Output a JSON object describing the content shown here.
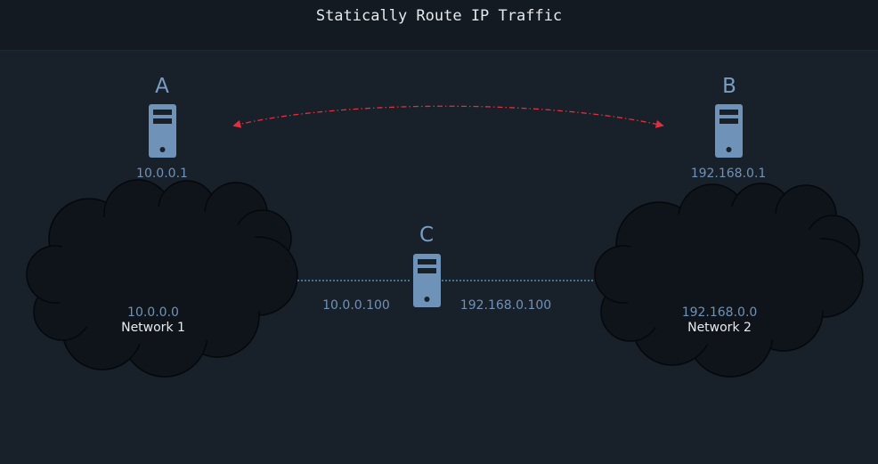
{
  "header": {
    "title": "Statically Route IP Traffic"
  },
  "nodes": {
    "a": {
      "label": "A",
      "ip": "10.0.0.1",
      "icon": "server-icon"
    },
    "b": {
      "label": "B",
      "ip": "192.168.0.1",
      "icon": "server-icon"
    },
    "c": {
      "label": "C",
      "ip_left": "10.0.0.100",
      "ip_right": "192.168.0.100",
      "icon": "server-icon"
    }
  },
  "networks": {
    "n1": {
      "address": "10.0.0.0",
      "name": "Network 1"
    },
    "n2": {
      "address": "192.168.0.0",
      "name": "Network 2"
    }
  },
  "colors": {
    "background": "#18202a",
    "server": "#6f92b8",
    "route_arc": "#e0303e",
    "link": "#5aa8cf",
    "cloud": "#0f141a"
  }
}
